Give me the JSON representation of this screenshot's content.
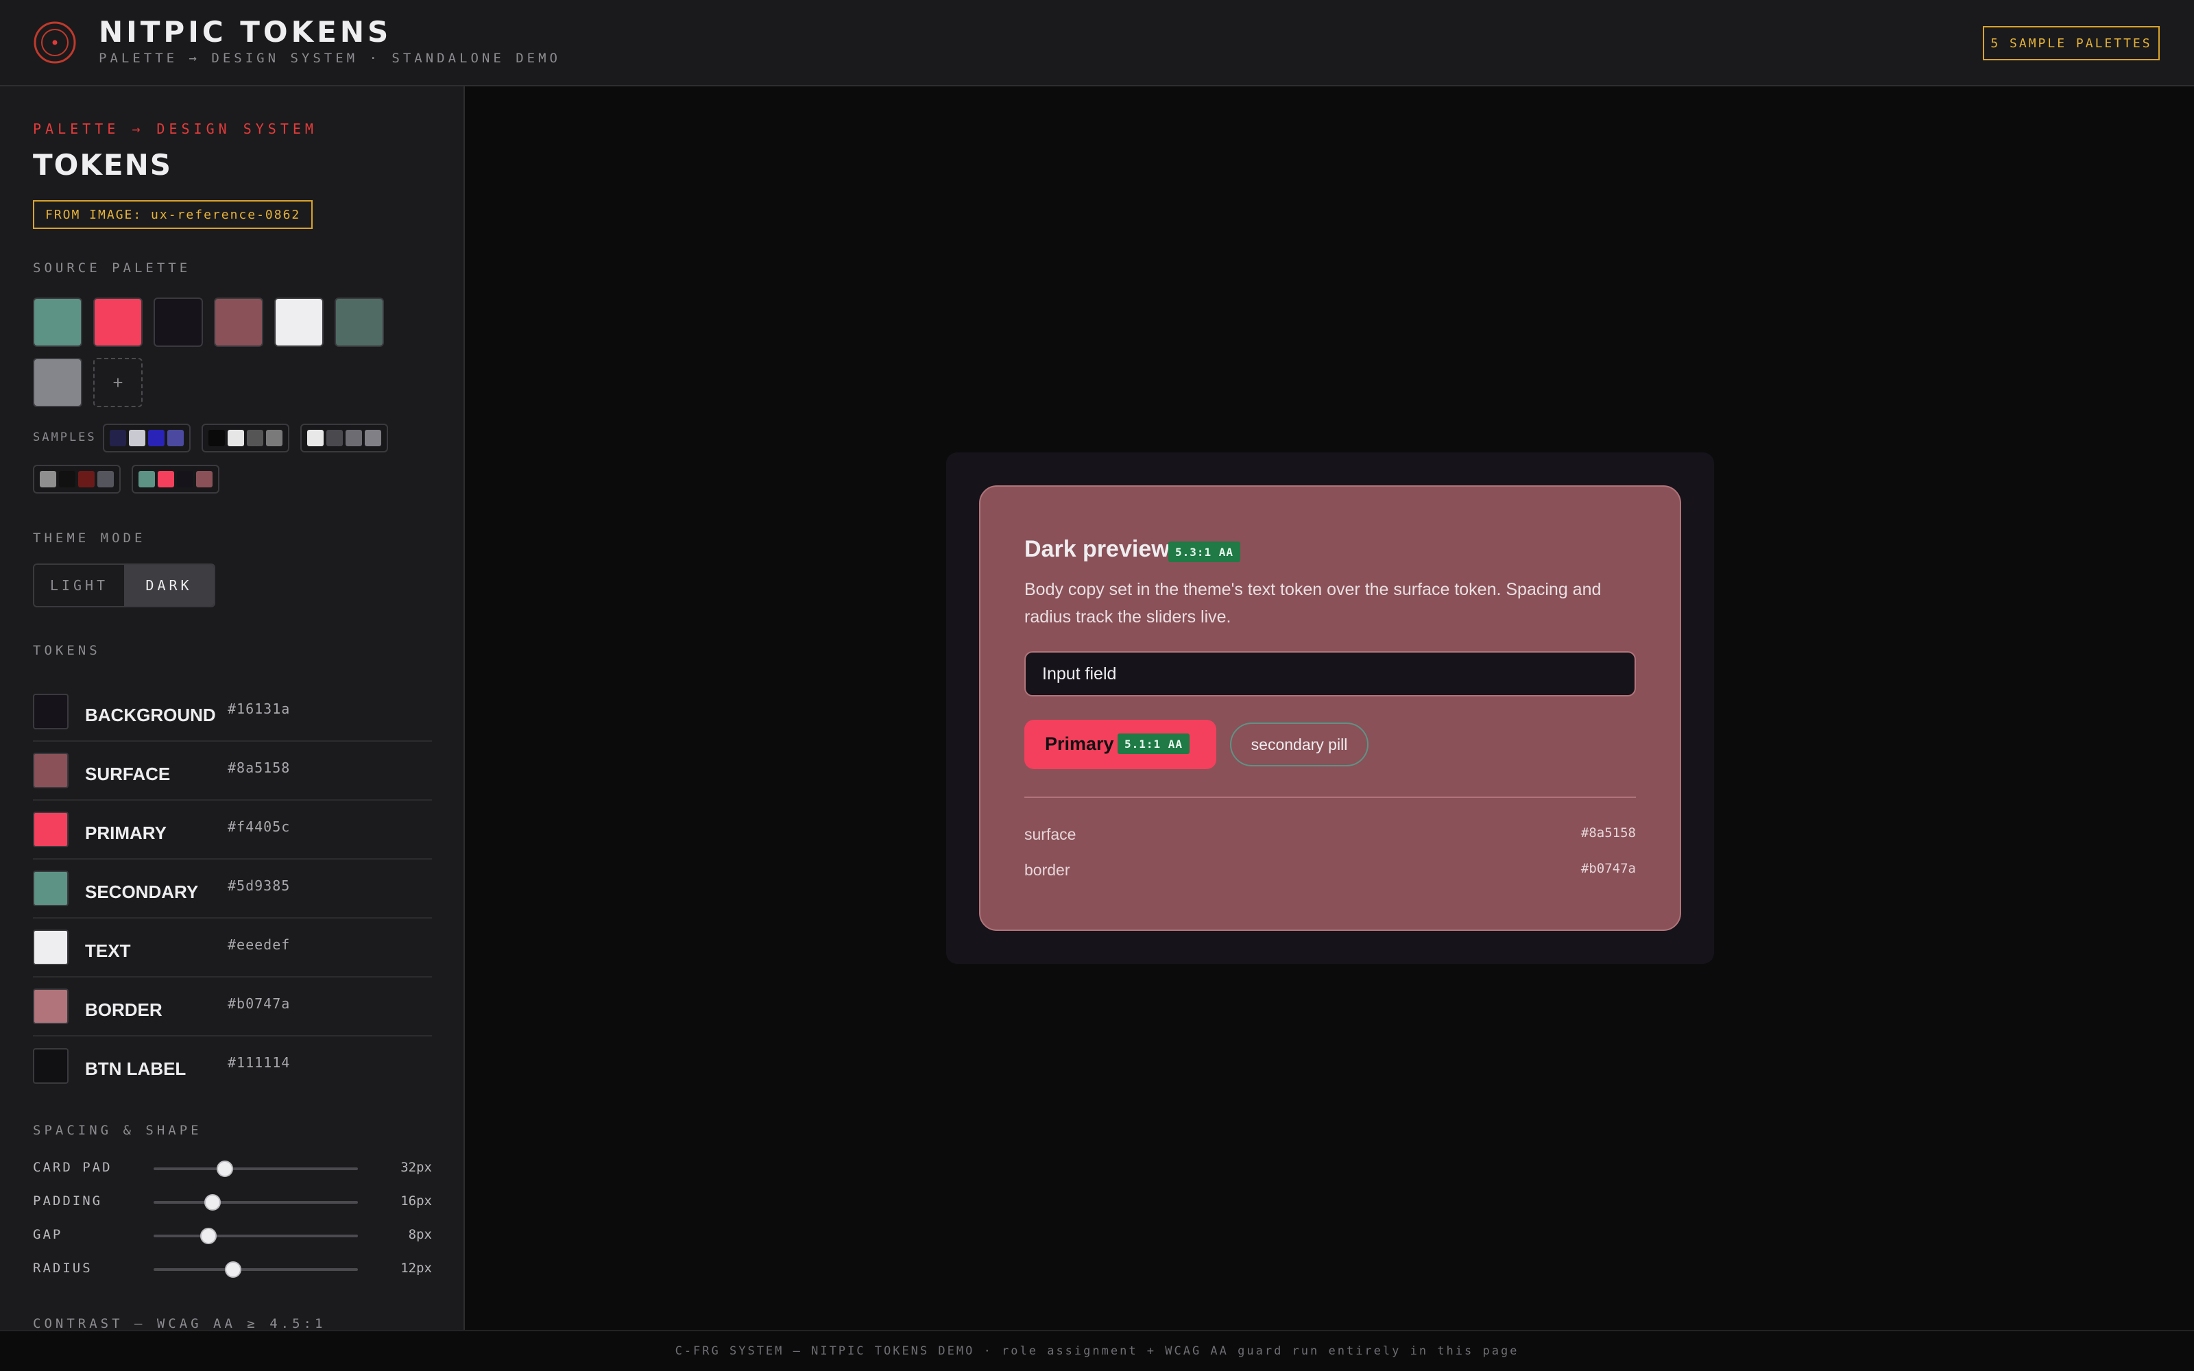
{
  "header": {
    "title": "NITPIC TOKENS",
    "subtitle": "PALETTE → DESIGN SYSTEM · STANDALONE DEMO",
    "samples_button": "5 SAMPLE PALETTES",
    "accent": "#e23b3b"
  },
  "sidebar": {
    "eyebrow": "PALETTE → DESIGN SYSTEM",
    "title": "TOKENS",
    "from_image": "FROM IMAGE: ux-reference-0862",
    "source_palette_label": "SOURCE PALETTE",
    "source_palette": [
      "#5d9385",
      "#f4405c",
      "#16131a",
      "#8a5158",
      "#eeedef",
      "#4f6b64",
      "#84868c"
    ],
    "add_swatch_label": "+",
    "samples_label": "SAMPLES",
    "samples": [
      [
        "#22224a",
        "#c9c9d1",
        "#2a23b8",
        "#4b4aa0"
      ],
      [
        "#0a0a0a",
        "#e6e6e6",
        "#555555",
        "#7a7a7a"
      ],
      [
        "#e8e8e8",
        "#4a4a4e",
        "#6c6c72",
        "#808086"
      ],
      [
        "#8f8f8f",
        "#111111",
        "#6b1a1a",
        "#55555e"
      ],
      [
        "#5d9385",
        "#f4405c",
        "#16131a",
        "#8a5158"
      ]
    ],
    "theme_mode_label": "THEME MODE",
    "theme_modes": [
      "LIGHT",
      "DARK"
    ],
    "theme_selected": "DARK",
    "tokens_label": "TOKENS",
    "tokens": [
      {
        "name": "BACKGROUND",
        "hex": "#16131a"
      },
      {
        "name": "SURFACE",
        "hex": "#8a5158"
      },
      {
        "name": "PRIMARY",
        "hex": "#f4405c"
      },
      {
        "name": "SECONDARY",
        "hex": "#5d9385"
      },
      {
        "name": "TEXT",
        "hex": "#eeedef"
      },
      {
        "name": "BORDER",
        "hex": "#b0747a"
      },
      {
        "name": "BTN LABEL",
        "hex": "#111114"
      }
    ],
    "spacing_label": "SPACING & SHAPE",
    "sliders": [
      {
        "label": "CARD PAD",
        "value": "32px",
        "level": 0.35
      },
      {
        "label": "PADDING",
        "value": "16px",
        "level": 0.29
      },
      {
        "label": "GAP",
        "value": "8px",
        "level": 0.27
      },
      {
        "label": "RADIUS",
        "value": "12px",
        "level": 0.39
      }
    ],
    "contrast_label": "CONTRAST — WCAG AA ≥ 4.5:1"
  },
  "preview": {
    "title": "Dark preview",
    "title_badge": "5.3:1 AA",
    "body": "Body copy set in the theme's text token over the surface token. Spacing and radius track the sliders live.",
    "input_value": "Input field",
    "primary_label": "Primary",
    "primary_badge": "5.1:1 AA",
    "secondary_label": "secondary pill",
    "rows": [
      {
        "key": "surface",
        "value": "#8a5158"
      },
      {
        "key": "border",
        "value": "#b0747a"
      }
    ]
  },
  "footer": {
    "text": "C-FRG SYSTEM — NITPIC TOKENS DEMO · role assignment + WCAG AA guard run entirely in this page"
  }
}
